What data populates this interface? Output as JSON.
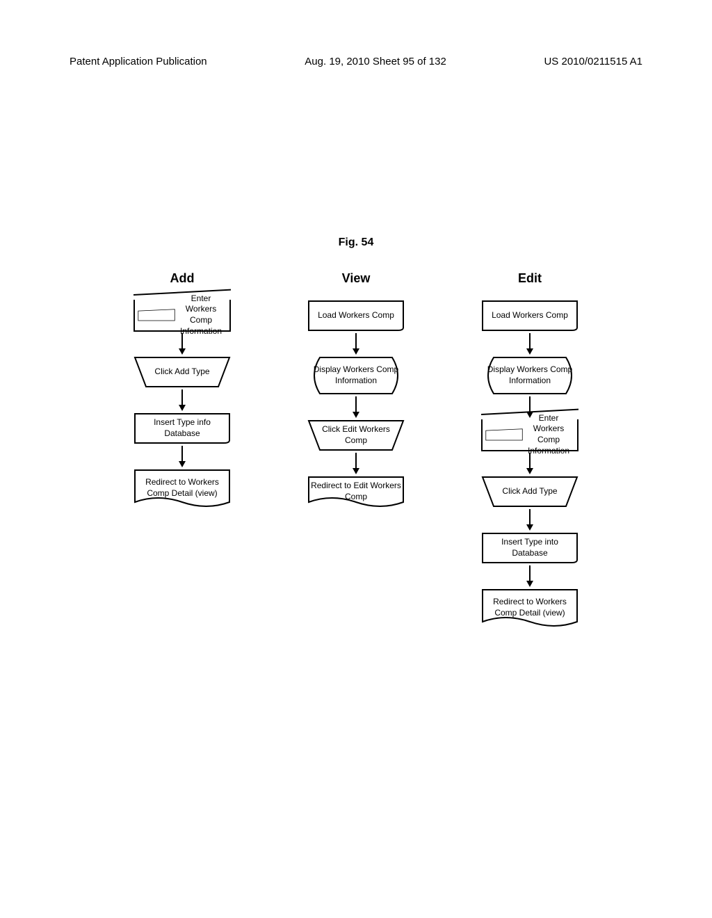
{
  "header": {
    "left": "Patent Application Publication",
    "center": "Aug. 19, 2010  Sheet 95 of 132",
    "right": "US 2010/0211515 A1"
  },
  "figure_title": "Fig. 54",
  "columns": [
    {
      "title": "Add",
      "nodes": [
        {
          "shape": "parallelogram",
          "text": "Enter Workers Comp Information"
        },
        {
          "shape": "trapezoid",
          "text": "Click Add Type"
        },
        {
          "shape": "card",
          "text": "Insert Type info Database"
        },
        {
          "shape": "document",
          "text": "Redirect to Workers Comp Detail (view)"
        }
      ]
    },
    {
      "title": "View",
      "nodes": [
        {
          "shape": "card",
          "text": "Load Workers Comp"
        },
        {
          "shape": "display-shape",
          "text": "Display Workers Comp Information"
        },
        {
          "shape": "trapezoid",
          "text": "Click Edit Workers Comp"
        },
        {
          "shape": "document",
          "text": "Redirect to Edit Workers Comp"
        }
      ]
    },
    {
      "title": "Edit",
      "nodes": [
        {
          "shape": "card",
          "text": "Load Workers Comp"
        },
        {
          "shape": "display-shape",
          "text": "Display Workers Comp Information"
        },
        {
          "shape": "parallelogram",
          "text": "Enter Workers Comp Information"
        },
        {
          "shape": "trapezoid",
          "text": "Click Add Type"
        },
        {
          "shape": "card",
          "text": "Insert Type into Database"
        },
        {
          "shape": "document",
          "text": "Redirect to Workers Comp Detail (view)"
        }
      ]
    }
  ]
}
